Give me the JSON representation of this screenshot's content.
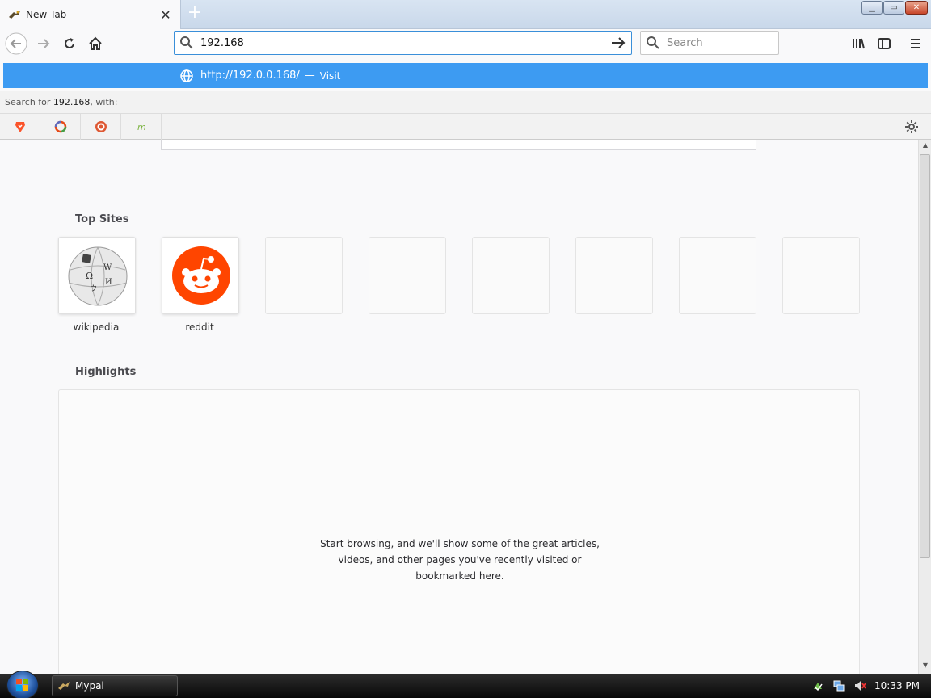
{
  "tab": {
    "title": "New Tab",
    "close": "✕",
    "new": "+"
  },
  "window": {
    "minimize": "▁",
    "maximize": "▭",
    "close": "✕"
  },
  "urlbar": {
    "value": "192.168"
  },
  "searchbar": {
    "placeholder": "Search"
  },
  "autocomplete": {
    "url": "http://192.0.0.168/",
    "separator": "—",
    "action": "Visit",
    "search_prefix": "Search for",
    "search_term": "192.168",
    "search_suffix": ", with:"
  },
  "top_sites": {
    "title": "Top Sites",
    "tiles": [
      {
        "label": "wikipedia"
      },
      {
        "label": "reddit"
      },
      {
        "label": ""
      },
      {
        "label": ""
      },
      {
        "label": ""
      },
      {
        "label": ""
      },
      {
        "label": ""
      },
      {
        "label": ""
      }
    ]
  },
  "highlights": {
    "title": "Highlights",
    "empty_line1": "Start browsing, and we'll show some of the great articles,",
    "empty_line2": "videos, and other pages you've recently visited or",
    "empty_line3": "bookmarked here."
  },
  "taskbar": {
    "task_label": "Mypal",
    "clock": "10:33 PM"
  },
  "colors": {
    "accent": "#3d9bf2",
    "reddit": "#ff4500"
  }
}
